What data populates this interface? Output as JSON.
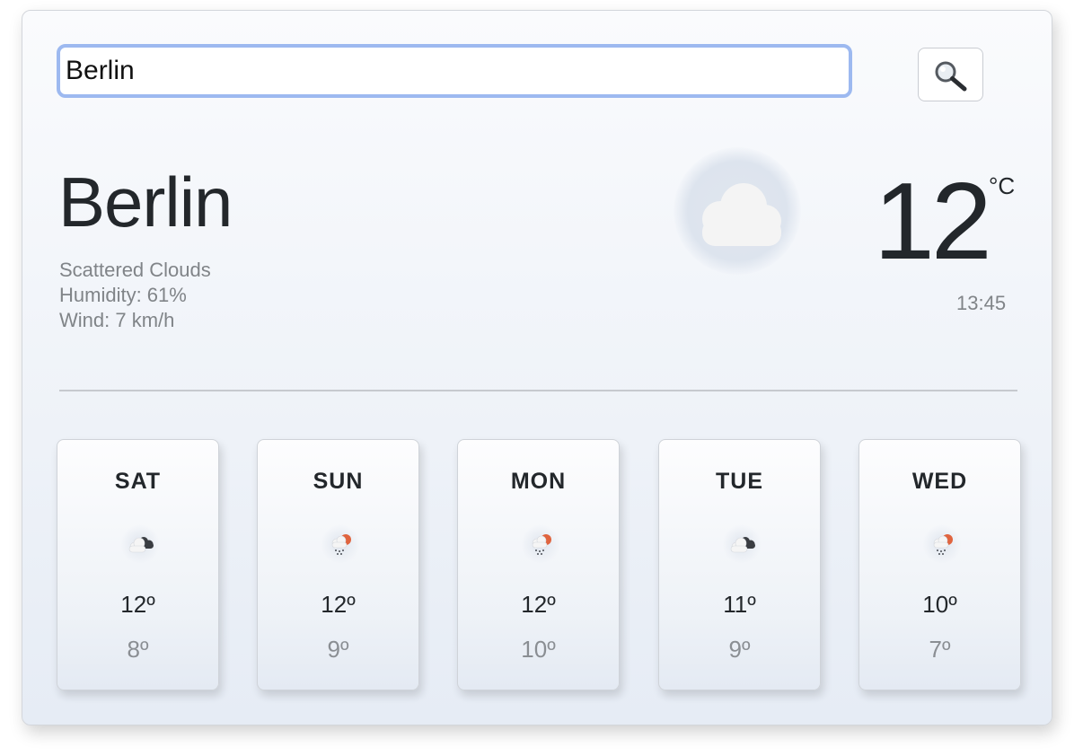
{
  "search": {
    "value": "Berlin"
  },
  "current": {
    "city": "Berlin",
    "description": "Scattered Clouds",
    "humidity": "Humidity: 61%",
    "wind": "Wind: 7 km/h",
    "temperature": "12",
    "unit": "°C",
    "time": "13:45",
    "icon": "cloud-icon"
  },
  "forecast": [
    {
      "day": "SAT",
      "high": "12º",
      "low": "8º",
      "icon": "partly-cloudy-icon"
    },
    {
      "day": "SUN",
      "high": "12º",
      "low": "9º",
      "icon": "rain-sun-icon"
    },
    {
      "day": "MON",
      "high": "12º",
      "low": "10º",
      "icon": "rain-sun-icon"
    },
    {
      "day": "TUE",
      "high": "11º",
      "low": "9º",
      "icon": "partly-cloudy-icon"
    },
    {
      "day": "WED",
      "high": "10º",
      "low": "7º",
      "icon": "rain-sun-icon"
    }
  ],
  "colors": {
    "search_focus_border": "#9db9f0",
    "primary_text": "#23272b",
    "secondary_text": "#808488"
  }
}
